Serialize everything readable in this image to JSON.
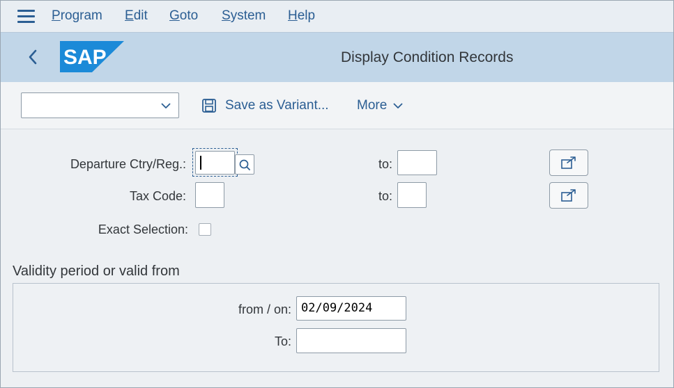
{
  "menu": {
    "items": [
      {
        "label": "Program"
      },
      {
        "label": "Edit"
      },
      {
        "label": "Goto"
      },
      {
        "label": "System"
      },
      {
        "label": "Help"
      }
    ]
  },
  "header": {
    "logo_text": "SAP",
    "title": "Display Condition Records"
  },
  "toolbar": {
    "variant_value": "",
    "save_variant_label": "Save as Variant...",
    "more_label": "More"
  },
  "form": {
    "departure": {
      "label": "Departure Ctry/Reg.:",
      "value": "",
      "to_label": "to:",
      "to_value": ""
    },
    "tax_code": {
      "label": "Tax Code:",
      "value": "",
      "to_label": "to:",
      "to_value": ""
    },
    "exact_selection": {
      "label": "Exact Selection:",
      "checked": false
    }
  },
  "validity": {
    "section_title": "Validity period or valid from",
    "from_label": "from / on:",
    "from_value": "02/09/2024",
    "to_label": "To:",
    "to_value": ""
  },
  "colors": {
    "accent": "#2b5e93",
    "header_bg": "#c1d6e8",
    "sap_logo_bg": "#1b8ad8",
    "background": "#edf0f3"
  }
}
